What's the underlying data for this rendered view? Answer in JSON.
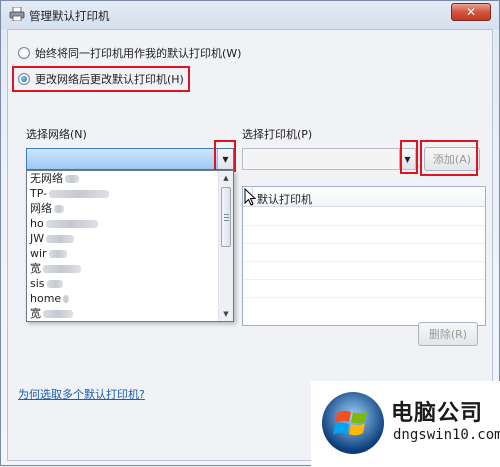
{
  "window": {
    "title": "管理默认打印机",
    "close_label": "✕"
  },
  "options": {
    "always_same": "始终将同一打印机用作我的默认打印机(W)",
    "change_per_network": "更改网络后更改默认打印机(H)",
    "selected": "change_per_network"
  },
  "network": {
    "label": "选择网络(N)",
    "selected_value": "",
    "items": [
      "无网络",
      "TP-",
      "网络",
      "ho",
      "JW",
      "wir",
      "宽",
      "sis",
      "home",
      "宽"
    ]
  },
  "printer": {
    "label": "选择打印机(P)",
    "selected_value": ""
  },
  "buttons": {
    "add": "添加(A)",
    "delete": "删除(R)"
  },
  "table": {
    "columns": [
      "默认打印机"
    ]
  },
  "help_link": "为何选取多个默认打印机?",
  "watermark": {
    "title": "电脑公司",
    "site": "dngswin10.com"
  }
}
